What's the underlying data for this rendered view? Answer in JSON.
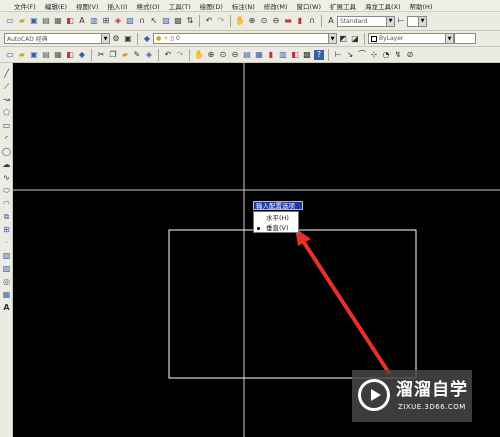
{
  "menu": {
    "items": [
      "文件(F)",
      "编辑(E)",
      "视图(V)",
      "插入(I)",
      "格式(O)",
      "工具(T)",
      "绘图(D)",
      "标注(N)",
      "修改(M)",
      "窗口(W)",
      "扩展工具",
      "海龙工具(X)",
      "帮助(H)"
    ]
  },
  "toolbar": {
    "text_style_value": "Standard",
    "workspace_value": "AutoCAD 经典",
    "layer_value": "0",
    "color_value": "ByLayer"
  },
  "popup": {
    "title": "输入配置选项",
    "options": [
      {
        "label": "水平(H)",
        "selected": false
      },
      {
        "label": "垂直(V)",
        "selected": true
      }
    ]
  },
  "watermark": {
    "name": "溜溜自学",
    "url": "ZIXUE.3D66.COM"
  },
  "colors": {
    "canvas": "#000000",
    "crosshair": "#c8c8c8",
    "rectangle": "#ffffff",
    "annotation_arrow": "#e8302a",
    "popup_title_bg": "#1f3aa0"
  }
}
